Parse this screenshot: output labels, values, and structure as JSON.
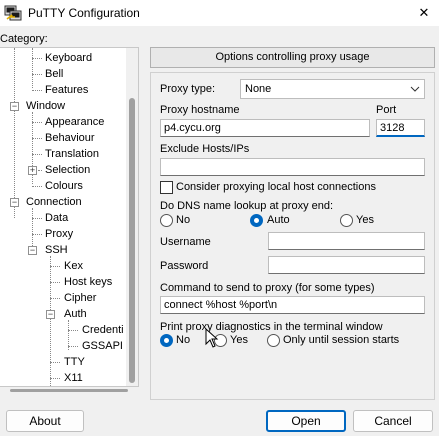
{
  "window": {
    "title": "PuTTY Configuration",
    "close_glyph": "✕"
  },
  "category_label": "Category:",
  "tree": {
    "items": [
      {
        "label": "Keyboard"
      },
      {
        "label": "Bell"
      },
      {
        "label": "Features"
      },
      {
        "label": "Window",
        "expander": "−"
      },
      {
        "label": "Appearance"
      },
      {
        "label": "Behaviour"
      },
      {
        "label": "Translation"
      },
      {
        "label": "Selection",
        "expander": "+"
      },
      {
        "label": "Colours"
      },
      {
        "label": "Connection",
        "expander": "−"
      },
      {
        "label": "Data"
      },
      {
        "label": "Proxy",
        "selected": true
      },
      {
        "label": "SSH",
        "expander": "−"
      },
      {
        "label": "Kex"
      },
      {
        "label": "Host keys"
      },
      {
        "label": "Cipher"
      },
      {
        "label": "Auth",
        "expander": "−"
      },
      {
        "label": "Credenti"
      },
      {
        "label": "GSSAPI"
      },
      {
        "label": "TTY"
      },
      {
        "label": "X11"
      }
    ]
  },
  "panel": {
    "header": "Options controlling proxy usage",
    "proxy_type_label": "Proxy type:",
    "proxy_type_value": "None",
    "hostname_label": "Proxy hostname",
    "hostname_value": "p4.cycu.org",
    "port_label": "Port",
    "port_value": "3128",
    "exclude_label": "Exclude Hosts/IPs",
    "exclude_value": "",
    "local_checkbox_label": "Consider proxying local host connections",
    "dns_label": "Do DNS name lookup at proxy end:",
    "dns_options": [
      "No",
      "Auto",
      "Yes"
    ],
    "dns_selected": "Auto",
    "username_label": "Username",
    "username_value": "",
    "password_label": "Password",
    "password_value": "",
    "command_label": "Command to send to proxy (for some types)",
    "command_value": "connect %host %port\\n",
    "diag_label": "Print proxy diagnostics in the terminal window",
    "diag_options": [
      "No",
      "Yes",
      "Only until session starts"
    ],
    "diag_selected": "No"
  },
  "buttons": {
    "about": "About",
    "open": "Open",
    "cancel": "Cancel"
  },
  "colors": {
    "accent": "#0067c0",
    "background": "#f0f0f0"
  }
}
